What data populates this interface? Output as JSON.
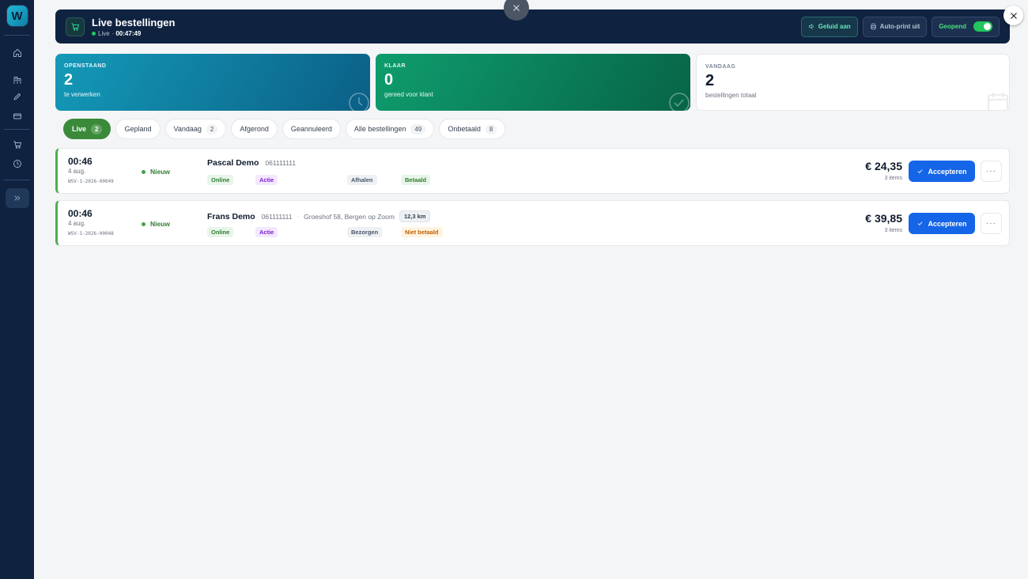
{
  "app": {
    "logo_letter": "W"
  },
  "header": {
    "title": "Live bestellingen",
    "live_label": "Live",
    "clock": "00:47:49",
    "sound_label": "Geluid aan",
    "autoprint_label": "Auto-print uit",
    "open_label": "Geopend",
    "open_state": true
  },
  "stats": [
    {
      "label": "OPENSTAAND",
      "value": "2",
      "desc": "te verwerken"
    },
    {
      "label": "KLAAR",
      "value": "0",
      "desc": "gereed voor klant"
    },
    {
      "label": "VANDAAG",
      "value": "2",
      "desc": "bestellingen totaal"
    }
  ],
  "tabs": [
    {
      "label": "Live",
      "count": "2"
    },
    {
      "label": "Gepland",
      "count": ""
    },
    {
      "label": "Vandaag",
      "count": "2"
    },
    {
      "label": "Afgerond",
      "count": ""
    },
    {
      "label": "Geannuleerd",
      "count": ""
    },
    {
      "label": "Alle bestellingen",
      "count": "49"
    },
    {
      "label": "Onbetaald",
      "count": "8"
    }
  ],
  "orders": [
    {
      "time": "00:46",
      "date": "4 aug.",
      "id": "WSV-1-2026-00049",
      "status": "Nieuw",
      "name": "Pascal Demo",
      "phone": "061111111",
      "address": "",
      "distance": "",
      "channel": "Online",
      "promo": "Actie",
      "method": "Afhalen",
      "payment": "Betaald",
      "price": "€ 24,35",
      "items": "3 items",
      "accept_label": "Accepteren"
    },
    {
      "time": "00:46",
      "date": "4 aug.",
      "id": "WSV-1-2026-00048",
      "status": "Nieuw",
      "name": "Frans Demo",
      "phone": "061111111",
      "address": "Groeshof 58, Bergen op Zoom",
      "distance": "12,3 km",
      "channel": "Online",
      "promo": "Actie",
      "method": "Bezorgen",
      "payment": "Niet betaald",
      "price": "€ 39,85",
      "items": "3 items",
      "accept_label": "Accepteren"
    }
  ],
  "colors": {
    "sidebar": "#0f2340",
    "accent_green": "#3a8a3a",
    "accept_blue": "#1565e8",
    "card_open": "#149ab8",
    "card_ready": "#0f9d6e"
  }
}
